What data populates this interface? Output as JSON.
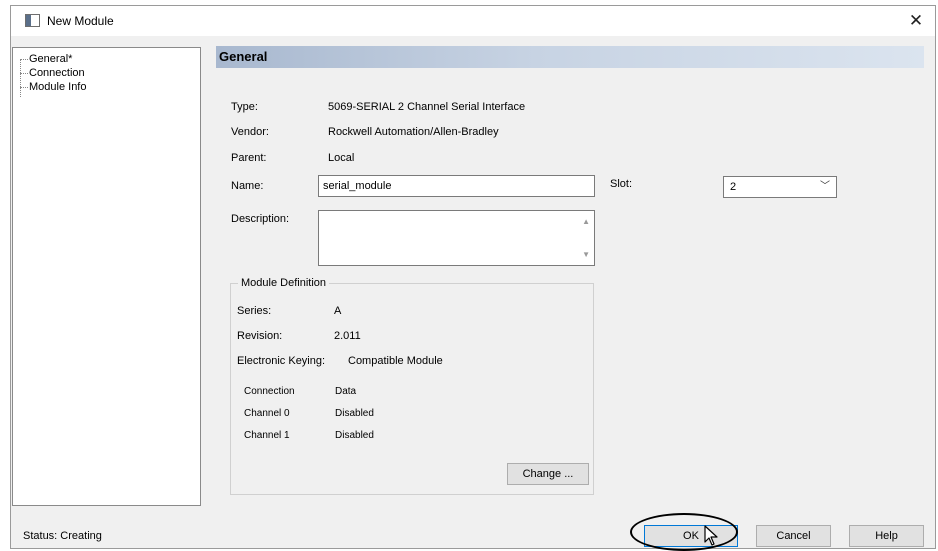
{
  "window": {
    "title": "New Module"
  },
  "tree": {
    "items": [
      {
        "label": "General*"
      },
      {
        "label": "Connection"
      },
      {
        "label": "Module Info"
      }
    ]
  },
  "panel": {
    "header": "General"
  },
  "fields": {
    "type_label": "Type:",
    "type_value": "5069-SERIAL 2 Channel Serial Interface",
    "vendor_label": "Vendor:",
    "vendor_value": "Rockwell Automation/Allen-Bradley",
    "parent_label": "Parent:",
    "parent_value": "Local",
    "name_label": "Name:",
    "name_value": "serial_module",
    "slot_label": "Slot:",
    "slot_value": "2",
    "description_label": "Description:",
    "description_value": ""
  },
  "module_definition": {
    "title": "Module Definition",
    "series_label": "Series:",
    "series_value": "A",
    "revision_label": "Revision:",
    "revision_value": "2.011",
    "keying_label": "Electronic Keying:",
    "keying_value": "Compatible Module",
    "rows": [
      {
        "label": "Connection",
        "value": "Data"
      },
      {
        "label": "Channel 0",
        "value": "Disabled"
      },
      {
        "label": "Channel 1",
        "value": "Disabled"
      }
    ],
    "change_button": "Change ..."
  },
  "status": {
    "text": "Status:  Creating"
  },
  "buttons": {
    "ok": "OK",
    "cancel": "Cancel",
    "help": "Help"
  },
  "icons": {
    "close": "close-icon",
    "window": "window-icon",
    "dropdown": "chevron-down-icon"
  }
}
